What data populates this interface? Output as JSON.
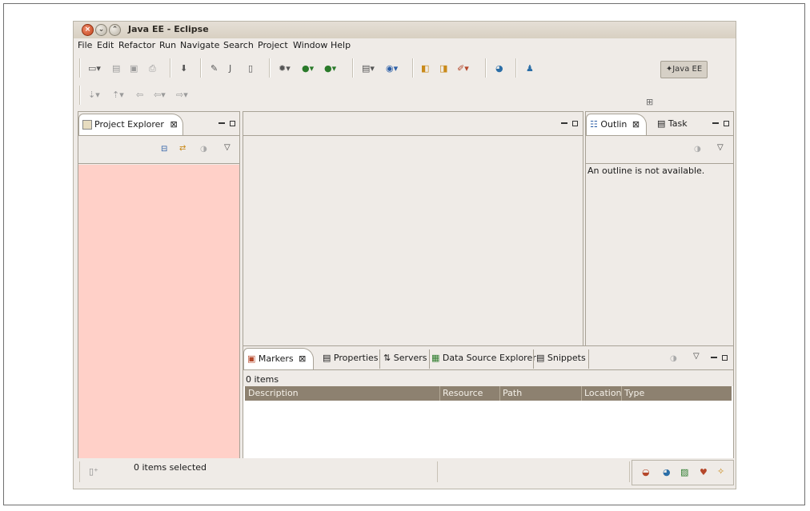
{
  "window": {
    "title": "Java EE - Eclipse"
  },
  "menubar": {
    "items": [
      "File",
      "Edit",
      "Refactor",
      "Run",
      "Navigate",
      "Search",
      "Project",
      "Window",
      "Help"
    ]
  },
  "perspective": {
    "label": "Java EE"
  },
  "project_explorer": {
    "tab_label": "Project Explorer",
    "close_glyph": "⊠"
  },
  "outline": {
    "tab_label": "Outlin",
    "close_glyph": "⊠",
    "message": "An outline is not available."
  },
  "task": {
    "tab_label": "Task"
  },
  "bottom": {
    "tabs": [
      "Markers",
      "Properties",
      "Servers",
      "Data Source Explorer",
      "Snippets"
    ],
    "markers_close_glyph": "⊠",
    "items_count": "0 items",
    "columns": [
      "Description",
      "Resource",
      "Path",
      "Location",
      "Type"
    ]
  },
  "status": {
    "selected_text": "0 items selected"
  },
  "colors": {
    "explorer_bg": "#ffd0c8",
    "table_header": "#8d8170",
    "window_bg": "#efebe7"
  },
  "icons": [
    "window-close-icon",
    "window-minimize-icon",
    "window-maximize-icon",
    "new-icon",
    "save-icon",
    "print-icon",
    "debug-icon",
    "run-icon",
    "java-ee-perspective-icon",
    "collapse-all-icon",
    "link-editor-icon"
  ]
}
